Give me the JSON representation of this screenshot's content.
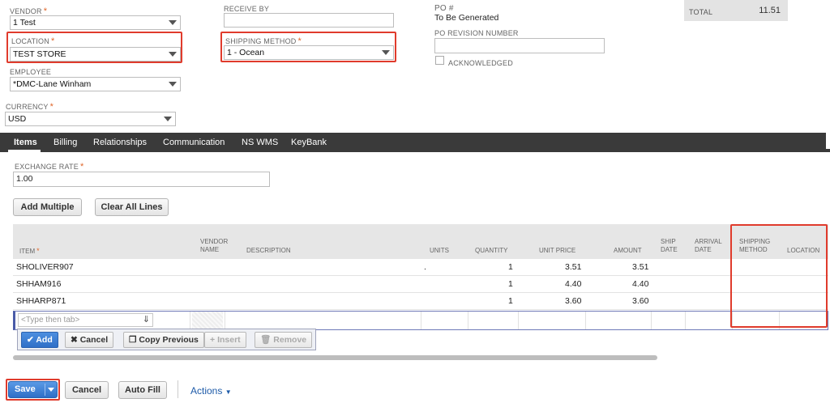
{
  "form": {
    "vendor": {
      "label": "VENDOR",
      "value": "1 Test"
    },
    "location": {
      "label": "LOCATION",
      "value": "TEST STORE"
    },
    "employee": {
      "label": "EMPLOYEE",
      "value": "*DMC-Lane Winham"
    },
    "currency": {
      "label": "CURRENCY",
      "value": "USD"
    },
    "receive_by": {
      "label": "RECEIVE BY",
      "value": ""
    },
    "shipping_method": {
      "label": "SHIPPING METHOD",
      "value": "1 - Ocean"
    },
    "po_number": {
      "label": "PO #",
      "value": "To Be Generated"
    },
    "po_revision": {
      "label": "PO REVISION NUMBER",
      "value": ""
    },
    "acknowledged": {
      "label": "ACKNOWLEDGED",
      "checked": false
    },
    "required_mark": "*"
  },
  "summary": {
    "total_label": "TOTAL",
    "total_value": "11.51"
  },
  "tabs": [
    {
      "label": "Items",
      "active": true
    },
    {
      "label": "Billing",
      "active": false
    },
    {
      "label": "Relationships",
      "active": false
    },
    {
      "label": "Communication",
      "active": false
    },
    {
      "label": "NS WMS",
      "active": false
    },
    {
      "label": "KeyBank",
      "active": false
    }
  ],
  "exchange_rate": {
    "label": "EXCHANGE RATE",
    "value": "1.00"
  },
  "sublist_buttons": {
    "add_multiple": "Add Multiple",
    "clear_all": "Clear All Lines"
  },
  "columns": {
    "item": "ITEM",
    "vendor_name": "VENDOR NAME",
    "description": "DESCRIPTION",
    "units": "UNITS",
    "quantity": "QUANTITY",
    "unit_price": "UNIT PRICE",
    "amount": "AMOUNT",
    "ship_date": "SHIP DATE",
    "arrival_date": "ARRIVAL DATE",
    "shipping_method": "SHIPPING METHOD",
    "location": "LOCATION"
  },
  "rows": [
    {
      "item": "SHOLIVER907",
      "units": ".",
      "quantity": "1",
      "unit_price": "3.51",
      "amount": "3.51"
    },
    {
      "item": "SHHAM916",
      "units": "",
      "quantity": "1",
      "unit_price": "4.40",
      "amount": "4.40"
    },
    {
      "item": "SHHARP871",
      "units": "",
      "quantity": "1",
      "unit_price": "3.60",
      "amount": "3.60"
    }
  ],
  "line_entry": {
    "placeholder": "<Type then tab>"
  },
  "line_buttons": {
    "add": "Add",
    "cancel": "Cancel",
    "copy_previous": "Copy Previous",
    "insert": "Insert",
    "remove": "Remove"
  },
  "footer": {
    "save": "Save",
    "cancel": "Cancel",
    "auto_fill": "Auto Fill",
    "actions": "Actions"
  },
  "colors": {
    "highlight": "#e03b2c",
    "primary": "#3b7bd4",
    "tabbar": "#3a3a3a"
  }
}
